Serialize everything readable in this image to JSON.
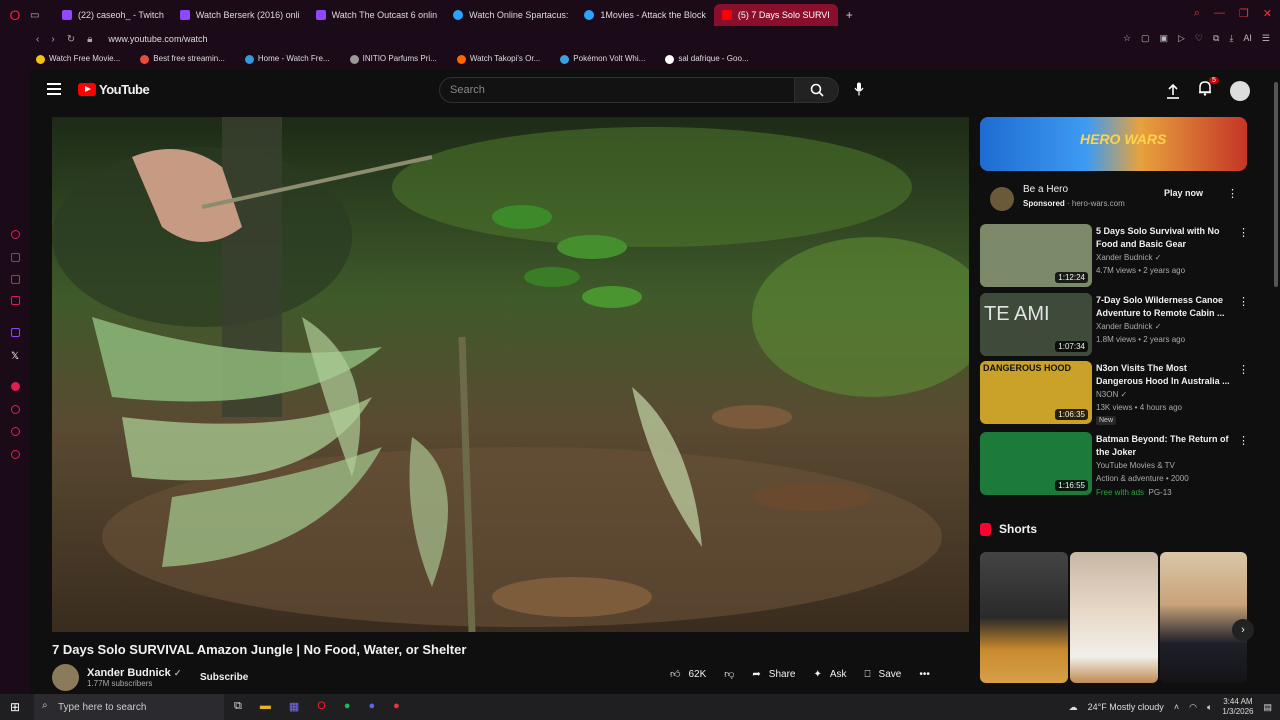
{
  "browser": {
    "tabs": [
      {
        "label": "(22) caseoh_ - Twitch",
        "color": "#9146ff"
      },
      {
        "label": "Watch Berserk (2016) onli",
        "color": "#9146ff"
      },
      {
        "label": "Watch The Outcast 6 onlin",
        "color": "#9146ff"
      },
      {
        "label": "Watch Online Spartacus: ",
        "color": "#2aa4ff"
      },
      {
        "label": "1Movies - Attack the Block",
        "color": "#2aa4ff"
      },
      {
        "label": "(5) 7 Days Solo SURVI",
        "color": "#ff0000"
      }
    ],
    "new_tab": "+",
    "url": "www.youtube.com/watch",
    "ai_label": "AI",
    "bookmarks": [
      {
        "label": "Watch Free Movie...",
        "color": "#f1c40f"
      },
      {
        "label": "Best free streamin...",
        "color": "#e74c3c"
      },
      {
        "label": "Home - Watch Fre...",
        "color": "#3498db"
      },
      {
        "label": "INITIO Parfums Pri...",
        "color": "#999999"
      },
      {
        "label": "Watch Takopi's Or...",
        "color": "#ff6600"
      },
      {
        "label": "Pokémon Volt Whi...",
        "color": "#3aa0e0"
      },
      {
        "label": "sal dafrique - Goo...",
        "color": "#ffffff"
      }
    ]
  },
  "youtube": {
    "logo_text": "YouTube",
    "search_placeholder": "Search",
    "notification_count": "5",
    "video_title": "7 Days Solo SURVIVAL Amazon Jungle | No Food, Water, or Shelter",
    "channel_name": "Xander Budnick",
    "subscribers": "1.77M subscribers",
    "subscribe_label": "Subscribe",
    "likes": "62K",
    "share_label": "Share",
    "ask_label": "Ask",
    "save_label": "Save",
    "ad": {
      "title": "Be a Hero",
      "sponsored": "Sponsored",
      "domain": "hero-wars.com",
      "cta": "Play now",
      "banner_text": "HERO WARS"
    },
    "recommended": [
      {
        "title": "5 Days Solo Survival with No Food and Basic Gear",
        "channel": "Xander Budnick",
        "meta": "4.7M views • 2 years ago",
        "duration": "1:12:24",
        "bg": "#7c8a6a"
      },
      {
        "title": "7-Day Solo Wilderness Canoe Adventure to Remote Cabin ...",
        "channel": "Xander Budnick",
        "meta": "1.8M views • 2 years ago",
        "duration": "1:07:34",
        "bg": "#3e4a3a",
        "overlay": "TE AMI"
      },
      {
        "title": "N3on Visits The Most Dangerous Hood In Australia ...",
        "channel": "N3ON",
        "meta": "13K views • 4 hours ago",
        "duration": "1:06:35",
        "badge": "New",
        "bg": "#c9a227",
        "overlay": "DANGEROUS HOOD"
      },
      {
        "title": "Batman Beyond: The Return of the Joker",
        "channel": "YouTube Movies & TV",
        "meta": "Action & adventure • 2000",
        "duration": "1:16:55",
        "extra": "Free with ads",
        "rating": "PG-13",
        "bg": "#1c7a3a"
      }
    ],
    "shorts_title": "Shorts"
  },
  "taskbar": {
    "search_placeholder": "Type here to search",
    "weather": "24°F  Mostly cloudy",
    "time": "3:44 AM",
    "date": "1/3/2026"
  }
}
